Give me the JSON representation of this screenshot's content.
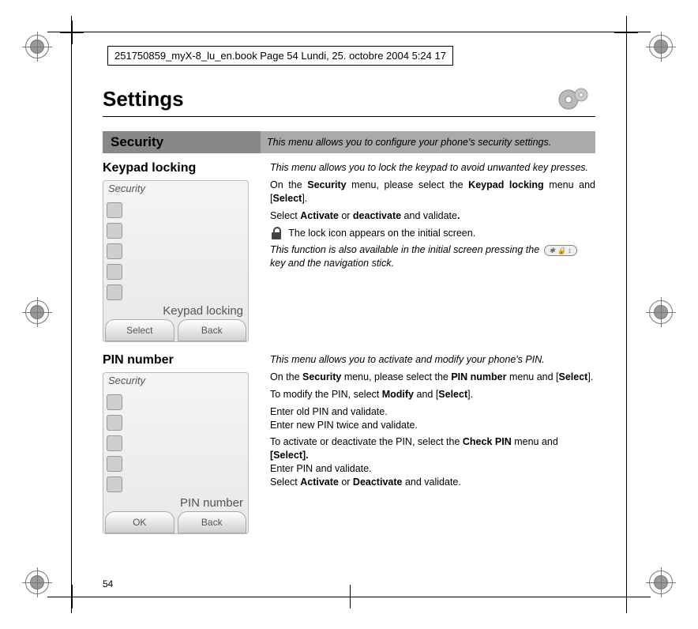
{
  "runner": "251750859_myX-8_lu_en.book  Page 54  Lundi, 25. octobre 2004  5:24 17",
  "title": "Settings",
  "page_number": "54",
  "section": {
    "label": "Security",
    "desc": "This menu allows you to configure your phone's security settings."
  },
  "keypad": {
    "heading": "Keypad locking",
    "intro": "This menu allows you to lock the keypad to avoid unwanted key presses.",
    "p1a": "On the ",
    "p1b": "Security",
    "p1c": " menu, please select the ",
    "p1d": "Keypad locking",
    "p1e": " menu and [",
    "p1f": "Select",
    "p1g": "].",
    "p2a": "Select ",
    "p2b": "Activate",
    "p2c": " or ",
    "p2d": "deactivate",
    "p2e": " and validate",
    "p2f": ".",
    "p3": " The lock icon appears on the initial screen.",
    "p4a": "This function is also available in the initial screen pressing the ",
    "p4b": " key and the navigation stick.",
    "key_label": "✱ 🔒 ↕",
    "shot": {
      "title": "Security",
      "caption": "Keypad locking",
      "sk_left": "Select",
      "sk_right": "Back"
    }
  },
  "pin": {
    "heading": "PIN number",
    "intro": "This menu allows you to activate and modify your phone's PIN.",
    "p1a": "On the ",
    "p1b": "Security",
    "p1c": " menu, please select the ",
    "p1d": "PIN number",
    "p1e": " menu and [",
    "p1f": "Select",
    "p1g": "].",
    "p2a": "To modify the PIN, select ",
    "p2b": "Modify",
    "p2c": " and [",
    "p2d": "Select",
    "p2e": "].",
    "p3": "Enter old PIN and validate.",
    "p4": "Enter new PIN twice and validate.",
    "p5a": "To activate or deactivate the PIN, select the ",
    "p5b": "Check PIN",
    "p5c": " menu and ",
    "p5d": "[Select].",
    "p6": "Enter PIN and validate.",
    "p7a": "Select ",
    "p7b": "Activate",
    "p7c": " or ",
    "p7d": "Deactivate",
    "p7e": " and validate.",
    "shot": {
      "title": "Security",
      "caption": "PIN number",
      "sk_left": "OK",
      "sk_right": "Back"
    }
  }
}
